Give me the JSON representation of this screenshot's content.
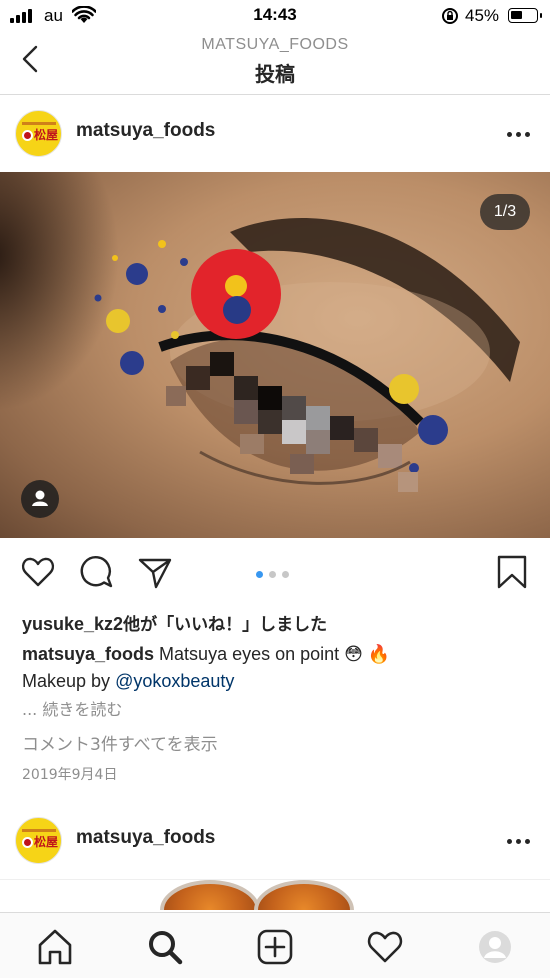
{
  "status_bar": {
    "carrier": "au",
    "time": "14:43",
    "battery": "45%"
  },
  "nav": {
    "subtitle": "MATSUYA_FOODS",
    "title": "投稿",
    "back_icon": "chevron-left-icon"
  },
  "post": {
    "username": "matsuya_foods",
    "avatar_text": "松屋",
    "photo_counter": "1/3",
    "carousel": {
      "current": 1,
      "total": 3
    },
    "likes_user": "yusuke_kz2",
    "likes_suffix": "他が「いいね！」しました",
    "caption_user": "matsuya_foods",
    "caption_text": " Matsuya eyes on point 😳 🔥",
    "caption_line2_prefix": "Makeup by ",
    "caption_mention": "@yokoxbeauty",
    "more_text": "... 続きを読む",
    "comments_link": "コメント3件すべてを表示",
    "date": "2019年9月4日"
  },
  "next_post": {
    "username": "matsuya_foods",
    "avatar_text": "松屋"
  },
  "icons": {
    "actions": [
      "heart-icon",
      "comment-icon",
      "share-icon",
      "bookmark-icon"
    ],
    "tabs": [
      "home-icon",
      "search-icon",
      "add-post-icon",
      "activity-heart-icon",
      "profile-avatar-icon"
    ]
  },
  "colors": {
    "link": "#003569",
    "active_dot": "#3897f0",
    "muted_text": "#8e8e8e",
    "brand_yellow": "#f6d417"
  }
}
